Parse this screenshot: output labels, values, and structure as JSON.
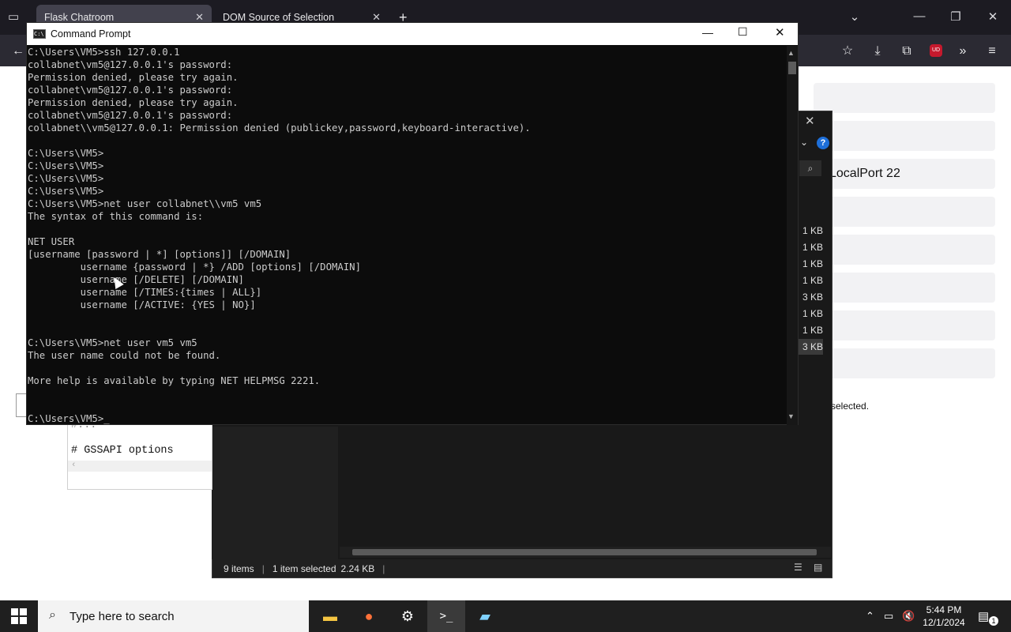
{
  "browser": {
    "tabs": [
      {
        "title": "Flask Chatroom",
        "active": true
      },
      {
        "title": "DOM Source of Selection",
        "active": false
      }
    ],
    "new_tab": "+",
    "tab_list_icon": "chevron-down-icon",
    "back": "←",
    "extension_badge": "UD"
  },
  "web": {
    "localport_text": "LocalPort 22",
    "selected_text": "selected."
  },
  "explorer": {
    "sizes": [
      "1 KB",
      "1 KB",
      "1 KB",
      "1 KB",
      "3 KB",
      "1 KB",
      "1 KB",
      "3 KB"
    ],
    "status": {
      "items": "9 items",
      "selected": "1 item selected",
      "size": "2.24 KB"
    }
  },
  "notepad": {
    "line1": "# GSSAPI options",
    "partial": "#..."
  },
  "cmd": {
    "title": "Command Prompt",
    "lines": [
      "C:\\Users\\VM5>ssh 127.0.0.1",
      "collabnet\\vm5@127.0.0.1's password:",
      "Permission denied, please try again.",
      "collabnet\\vm5@127.0.0.1's password:",
      "Permission denied, please try again.",
      "collabnet\\vm5@127.0.0.1's password:",
      "collabnet\\\\vm5@127.0.0.1: Permission denied (publickey,password,keyboard-interactive).",
      "",
      "C:\\Users\\VM5>",
      "C:\\Users\\VM5>",
      "C:\\Users\\VM5>",
      "C:\\Users\\VM5>",
      "C:\\Users\\VM5>net user collabnet\\\\vm5 vm5",
      "The syntax of this command is:",
      "",
      "NET USER",
      "[username [password | *] [options]] [/DOMAIN]",
      "         username {password | *} /ADD [options] [/DOMAIN]",
      "         username [/DELETE] [/DOMAIN]",
      "         username [/TIMES:{times | ALL}]",
      "         username [/ACTIVE: {YES | NO}]",
      "",
      "",
      "C:\\Users\\VM5>net user vm5 vm5",
      "The user name could not be found.",
      "",
      "More help is available by typing NET HELPMSG 2221.",
      "",
      "",
      "C:\\Users\\VM5>_"
    ]
  },
  "taskbar": {
    "search_placeholder": "Type here to search",
    "time": "5:44 PM",
    "date": "12/1/2024",
    "notification_count": "1"
  }
}
